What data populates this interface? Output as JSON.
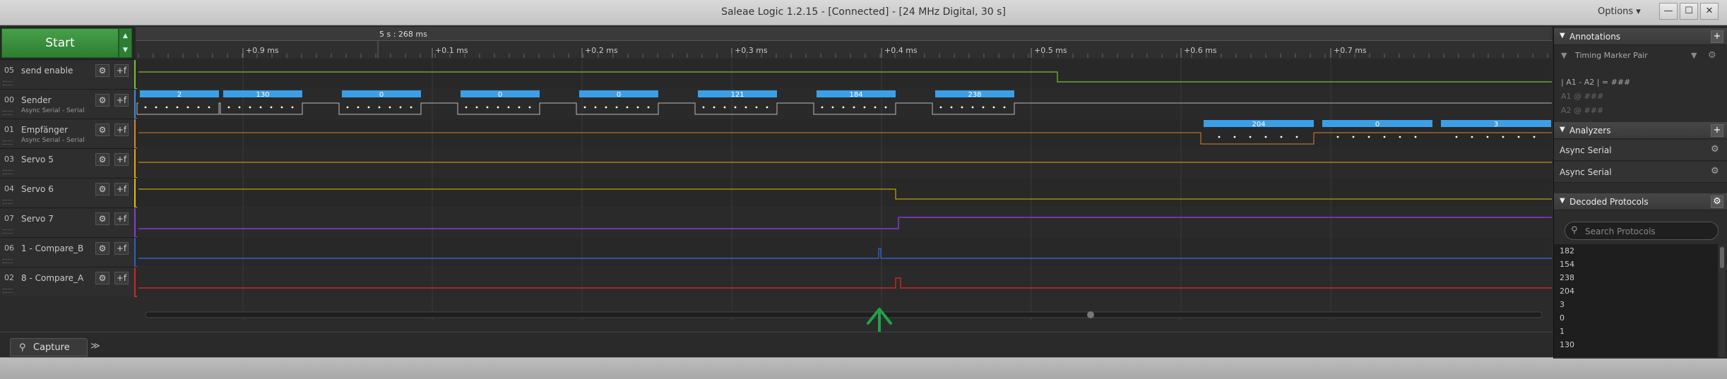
{
  "window": {
    "title": "Saleae Logic 1.2.15 - [Connected] - [24 MHz Digital, 30 s]",
    "options_label": "Options ▾",
    "min_glyph": "—",
    "max_glyph": "☐",
    "close_glyph": "✕"
  },
  "start_button": {
    "label": "Start"
  },
  "timestamp": "5 s : 268 ms",
  "time_ticks": [
    "+0.9 ms",
    "+0.1 ms",
    "+0.2 ms",
    "+0.3 ms",
    "+0.4 ms",
    "+0.5 ms",
    "+0.6 ms",
    "+0.7 ms"
  ],
  "channels": [
    {
      "num": "05",
      "name": "send enable",
      "sub": "",
      "color": "#7cbf2f"
    },
    {
      "num": "00",
      "name": "Sender",
      "sub": "Async Serial - Serial",
      "color": "#3b8be0"
    },
    {
      "num": "01",
      "name": "Empfänger",
      "sub": "Async Serial - Serial",
      "color": "#d9822b"
    },
    {
      "num": "03",
      "name": "Servo 5",
      "sub": "",
      "color": "#e6a514"
    },
    {
      "num": "04",
      "name": "Servo 6",
      "sub": "",
      "color": "#e0c000"
    },
    {
      "num": "07",
      "name": "Servo 7",
      "sub": "",
      "color": "#8a3bd6"
    },
    {
      "num": "06",
      "name": "1 - Compare_B",
      "sub": "",
      "color": "#2d62c6"
    },
    {
      "num": "02",
      "name": "8 - Compare_A",
      "sub": "",
      "color": "#d02626"
    }
  ],
  "sender_bytes": [
    "2",
    "130",
    "0",
    "0",
    "0",
    "121",
    "184",
    "238"
  ],
  "empfaenger_bytes": [
    "204",
    "0",
    "3"
  ],
  "capture_tab": {
    "label": "Capture",
    "expand": "≫"
  },
  "annotations": {
    "header": "Annotations",
    "marker_label": "Timing Marker Pair",
    "pair_line": "| A1 - A2 | = ###",
    "a1_line": "A1 @ ###",
    "a2_line": "A2 @ ###"
  },
  "analyzers": {
    "header": "Analyzers",
    "items": [
      "Async Serial",
      "Async Serial"
    ]
  },
  "decoded": {
    "header": "Decoded Protocols",
    "search_placeholder": "Search Protocols",
    "items": [
      "182",
      "154",
      "238",
      "204",
      "3",
      "0",
      "1",
      "130"
    ]
  },
  "colors": {
    "arrow": "#1fa24a",
    "byte_bar": "#3b9fe8",
    "grid": "#3c3c3c"
  }
}
